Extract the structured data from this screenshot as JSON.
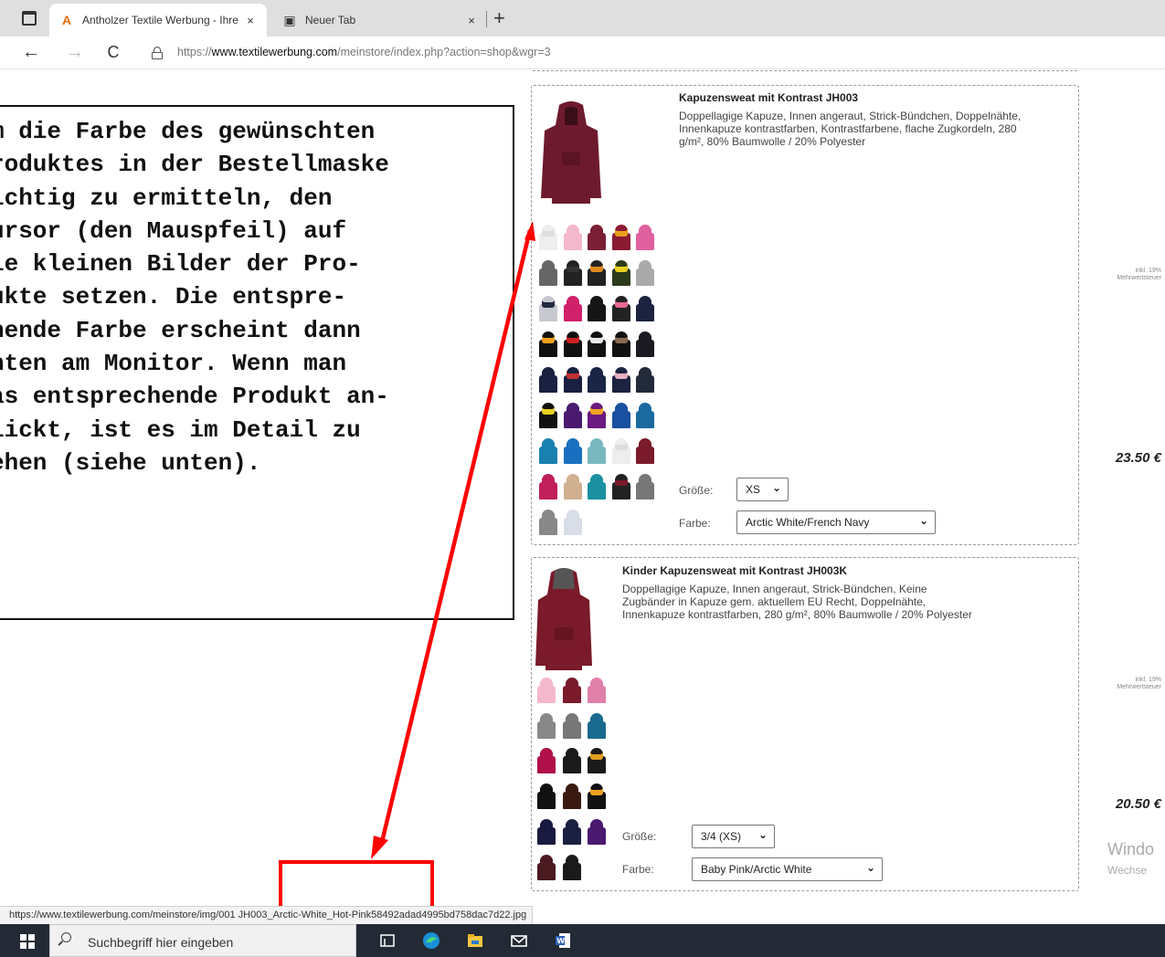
{
  "browser": {
    "tabs": [
      {
        "title": "Antholzer Textile Werbung - Ihre",
        "icon": "antholzer-logo-icon",
        "active": true
      },
      {
        "title": "Neuer Tab",
        "icon": "new-tab-page-icon",
        "active": false
      }
    ],
    "close_glyph": "×",
    "new_tab_glyph": "+",
    "back_glyph": "←",
    "forward_glyph": "→",
    "reload_glyph": "C",
    "url_prefix": "https://",
    "url_domain": "www.textilewerbung.com",
    "url_path": "/meinstore/index.php?action=shop&wgr=3"
  },
  "annotation": {
    "lines": [
      "m die Farbe des gewünschten",
      "roduktes in der Bestellmaske",
      "ichtig zu ermitteln, den",
      "ursor (den Mauspfeil) auf",
      "ie kleinen Bilder der Pro-",
      "ukte setzen. Die entspre-",
      "hende Farbe erscheint dann",
      "nten am Monitor. Wenn man",
      "as entsprechende Produkt an-",
      "lickt, ist es im Detail zu",
      "ehen (siehe unten)."
    ],
    "arrow_color": "#ff0000"
  },
  "products": [
    {
      "title": "Kapuzensweat mit Kontrast JH003",
      "description": "Doppellagige Kapuze, Innen angeraut, Strick-Bündchen, Doppelnähte, Innenkapuze kontrastfarben, Kontrastfarbene, flache Zugkordeln, 280 g/m², 80% Baumwolle / 20% Polyester",
      "tax_note": "inkl. 19% Mehrwertsteuer",
      "price": "23.50 €",
      "size_label": "Größe:",
      "size_value": "XS",
      "color_label": "Farbe:",
      "color_value": "Arctic White/French Navy",
      "main_color": "#6e1a2e",
      "swatch_rows": [
        [
          [
            "#eeeeee",
            "#dddddd"
          ],
          [
            "#f4b8cc",
            "#f4b8cc"
          ],
          [
            "#7a1f35",
            "#7a1f35"
          ],
          [
            "#8b1a33",
            "#e8a020"
          ],
          [
            "#e060a0",
            "#e060a0"
          ]
        ],
        [
          [
            "#666666",
            "#666666"
          ],
          [
            "#222222",
            "#333333"
          ],
          [
            "#222222",
            "#e08a20"
          ],
          [
            "#2b3a1a",
            "#e8d020"
          ],
          [
            "#aaaaaa",
            "#aaaaaa"
          ]
        ],
        [
          [
            "#c8c8d0",
            "#222a40"
          ],
          [
            "#d0206a",
            "#d0206a"
          ],
          [
            "#151515",
            "#151515"
          ],
          [
            "#222222",
            "#e86a90"
          ],
          [
            "#1c2340",
            "#1c2340"
          ]
        ],
        [
          [
            "#111111",
            "#f0a020"
          ],
          [
            "#111111",
            "#cc2020"
          ],
          [
            "#111111",
            "#e8e8e8"
          ],
          [
            "#111111",
            "#8a6a50"
          ],
          [
            "#1a1a20",
            "#1a1a20"
          ]
        ],
        [
          [
            "#1a2040",
            "#1a2040"
          ],
          [
            "#1a2040",
            "#c03030"
          ],
          [
            "#1a2545",
            "#1a2545"
          ],
          [
            "#1c2240",
            "#e8b0c0"
          ],
          [
            "#222a3a",
            "#222a3a"
          ]
        ],
        [
          [
            "#111111",
            "#e8d020"
          ],
          [
            "#4a1a70",
            "#4a1a70"
          ],
          [
            "#6a1a80",
            "#f0a020"
          ],
          [
            "#1a50a0",
            "#1a50a0"
          ],
          [
            "#1a6aa0",
            "#1a6aa0"
          ]
        ],
        [
          [
            "#1a80b0",
            "#1a80b0"
          ],
          [
            "#1a70c0",
            "#1a70c0"
          ],
          [
            "#7ab8c0",
            "#7ab8c0"
          ],
          [
            "#eeeeee",
            "#dddddd"
          ],
          [
            "#7a1a2a",
            "#7a1a2a"
          ]
        ],
        [
          [
            "#c0205a",
            "#c0205a"
          ],
          [
            "#d0b090",
            "#d0b090"
          ],
          [
            "#1a90a0",
            "#1a90a0"
          ],
          [
            "#222222",
            "#7a1a2a"
          ],
          [
            "#777777",
            "#777777"
          ]
        ],
        [
          [
            "#888888",
            "#888888"
          ],
          [
            "#d8dde8",
            "#d8dde8"
          ]
        ]
      ]
    },
    {
      "title": "Kinder Kapuzensweat mit Kontrast JH003K",
      "description": "Doppellagige Kapuze, Innen angeraut, Strick-Bündchen, Keine Zugbänder in Kapuze gem. aktuellem EU Recht, Doppelnähte, Innenkapuze kontrastfarben, 280 g/m², 80% Baumwolle / 20% Polyester",
      "tax_note": "inkl. 19% Mehrwertsteuer",
      "price": "20.50 €",
      "size_label": "Größe:",
      "size_value": "3/4 (XS)",
      "color_label": "Farbe:",
      "color_value": "Baby Pink/Arctic White",
      "main_color": "#7a1a2a",
      "swatch_rows": [
        [
          [
            "#f4b8cc",
            "#f4b8cc"
          ],
          [
            "#7a1a2a",
            "#7a1a2a"
          ],
          [
            "#e080a8",
            "#e080a8"
          ]
        ],
        [
          [
            "#888888",
            "#888888"
          ],
          [
            "#777777",
            "#777777"
          ],
          [
            "#1a6a90",
            "#1a6a90"
          ]
        ],
        [
          [
            "#b0104a",
            "#b0104a"
          ],
          [
            "#1a1a1a",
            "#1a1a1a"
          ],
          [
            "#1a1a1a",
            "#e0a020"
          ]
        ],
        [
          [
            "#111111",
            "#111111"
          ],
          [
            "#3a1a10",
            "#3a1a10"
          ],
          [
            "#111111",
            "#f0a020"
          ]
        ],
        [
          [
            "#1a1a40",
            "#1a1a40"
          ],
          [
            "#1a2040",
            "#1a2040"
          ],
          [
            "#4a1a70",
            "#4a1a70"
          ]
        ],
        [
          [
            "#4a1a20",
            "#4a1a20"
          ],
          [
            "#1a1a1a",
            "#1a1a1a"
          ]
        ]
      ]
    }
  ],
  "watermark": {
    "line1": "Windo",
    "line2": "Wechse"
  },
  "status_url": "https://www.textilewerbung.com/meinstore/img/001 JH003_Arctic-White_Hot-Pink58492adad4995bd758dac7d22.jpg",
  "taskbar": {
    "search_placeholder": "Suchbegriff hier eingeben",
    "icons": [
      "task-view-icon",
      "edge-icon",
      "file-explorer-icon",
      "mail-icon",
      "word-icon"
    ]
  }
}
